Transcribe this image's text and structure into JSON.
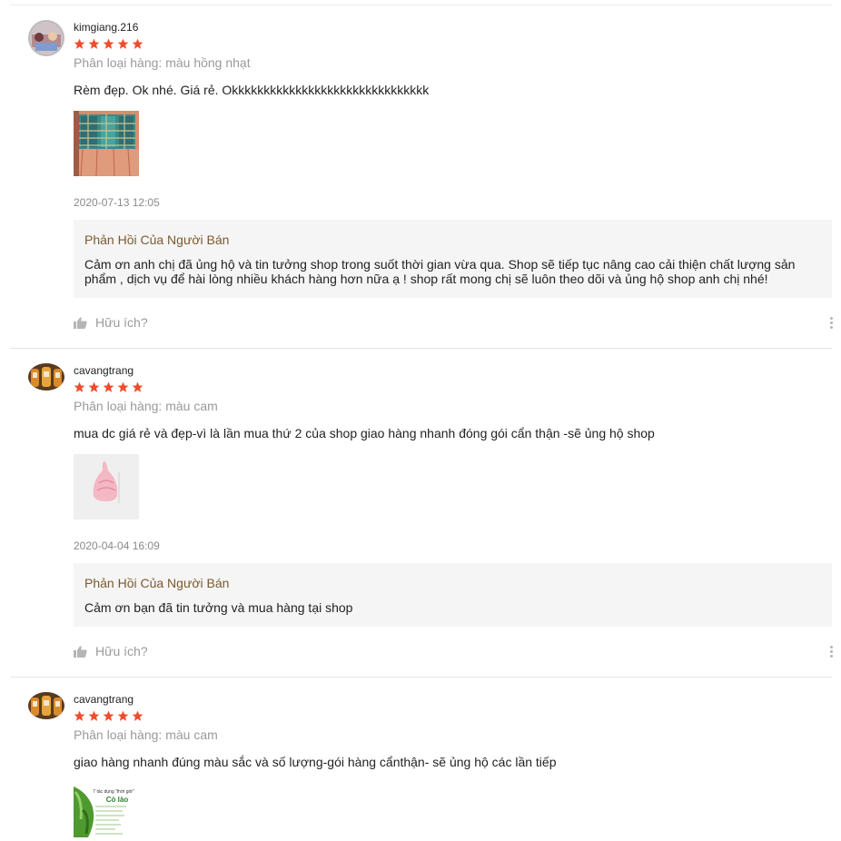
{
  "reviews": [
    {
      "username": "kimgiang.216",
      "rating": 5,
      "variation": "Phân loại hàng: màu hồng nhạt",
      "comment": "Rèm đẹp. Ok nhé. Giá rẻ. Okkkkkkkkkkkkkkkkkkkkkkkkkkkkkkk",
      "timestamp": "2020-07-13 12:05",
      "reply_title": "Phản Hồi Của Người Bán",
      "reply_text": "Cảm ơn anh chị đã ủng hộ và tin tưởng shop trong suốt thời gian vừa qua. Shop sẽ tiếp tục nâng cao cải thiện chất lượng sản phẩm , dịch vụ để hài lòng nhiều khách hàng hơn nữa ạ ! shop  rất mong chị sẽ luôn theo dõi và ủng hộ shop anh chị nhé!",
      "helpful_label": "Hữu ích?"
    },
    {
      "username": "cavangtrang",
      "rating": 5,
      "variation": "Phân loại hàng: màu cam",
      "comment": "mua dc giá rẻ và đẹp-vì là lần mua thứ 2 của shop giao hàng nhanh đóng gói cẩn thận -sẽ ủng hộ shop",
      "timestamp": "2020-04-04 16:09",
      "reply_title": "Phản Hồi Của Người Bán",
      "reply_text": "Cảm ơn bạn đã tin tưởng và mua hàng tại shop",
      "helpful_label": "Hữu ích?"
    },
    {
      "username": "cavangtrang",
      "rating": 5,
      "variation": "Phân loại hàng: màu cam",
      "comment": "giao hàng nhanh đúng màu sắc và số lượng-gói hàng cẩnthận- sẽ ủng hộ các lần tiếp",
      "thumb_caption_title": "7 tác dụng \"thời giờ\"",
      "thumb_caption_name": "Cỏ lào"
    }
  ],
  "colors": {
    "star": "#ee4d2d",
    "reply_title": "#7b5a2e",
    "reply_bg": "#f5f5f5",
    "muted": "#9a9a9a"
  }
}
